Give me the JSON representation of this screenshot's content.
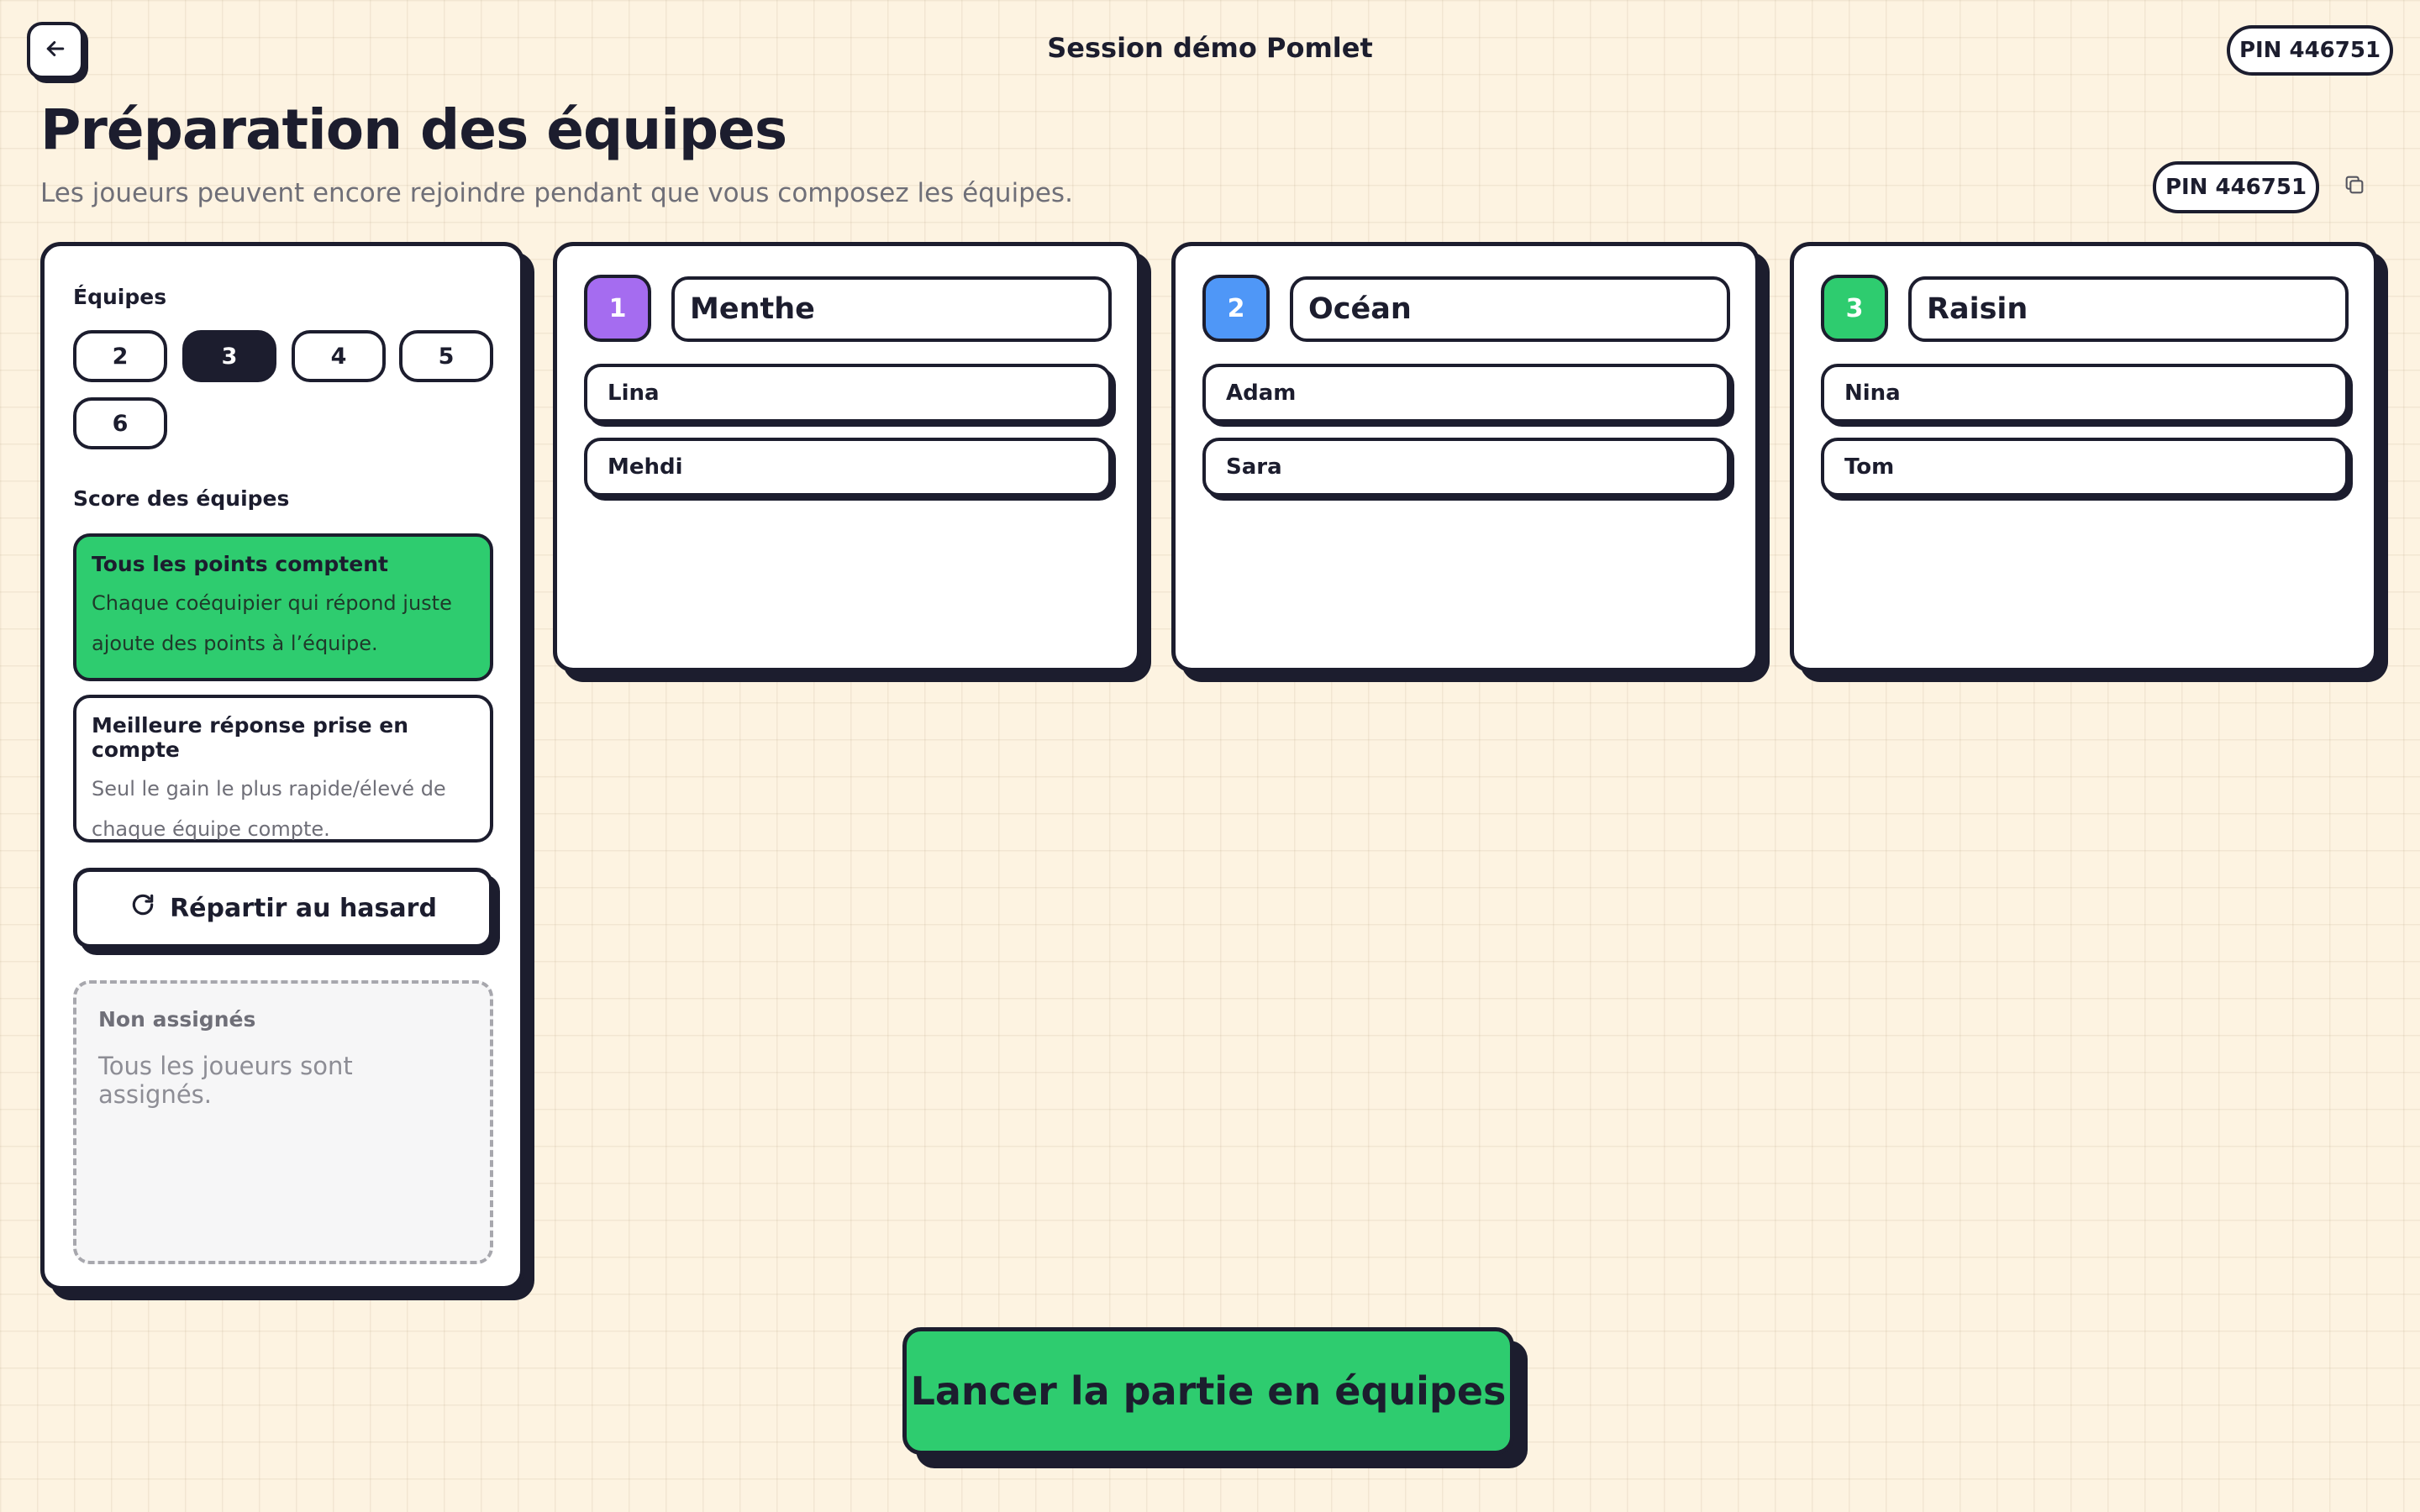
{
  "header": {
    "back_icon": "arrow-left-icon",
    "session_title": "Session démo Pomlet",
    "pin_label": "PIN 446751"
  },
  "heading": {
    "title": "Préparation des équipes",
    "subtitle": "Les joueurs peuvent encore rejoindre pendant que vous composez les équipes.",
    "pin_label": "PIN 446751",
    "copy_icon": "copy-icon"
  },
  "settings": {
    "teams_label": "Équipes",
    "team_counts": [
      "2",
      "3",
      "4",
      "5",
      "6"
    ],
    "selected_count": "3",
    "score_label": "Score des équipes",
    "score_modes": [
      {
        "title": "Tous les points comptent",
        "desc_line1": "Chaque coéquipier qui répond juste",
        "desc_line2": "ajoute des points à l’équipe.",
        "selected": true
      },
      {
        "title": "Meilleure réponse prise en compte",
        "desc_line1": "Seul le gain le plus rapide/élevé de",
        "desc_line2": "chaque équipe compte.",
        "selected": false
      }
    ],
    "shuffle_label": "Répartir au hasard",
    "shuffle_icon": "refresh-icon",
    "unassigned_title": "Non assignés",
    "unassigned_text": "Tous les joueurs sont assignés."
  },
  "teams": [
    {
      "number": "1",
      "name": "Menthe",
      "color": "#a56cf0",
      "players": [
        "Lina",
        "Mehdi"
      ]
    },
    {
      "number": "2",
      "name": "Océan",
      "color": "#4f97f7",
      "players": [
        "Adam",
        "Sara"
      ]
    },
    {
      "number": "3",
      "name": "Raisin",
      "color": "#2ecc6f",
      "players": [
        "Nina",
        "Tom"
      ]
    }
  ],
  "launch_label": "Lancer la partie en équipes",
  "colors": {
    "background": "#fdf3e1",
    "ink": "#1c1d2e",
    "accent_green": "#2ecc6f"
  }
}
